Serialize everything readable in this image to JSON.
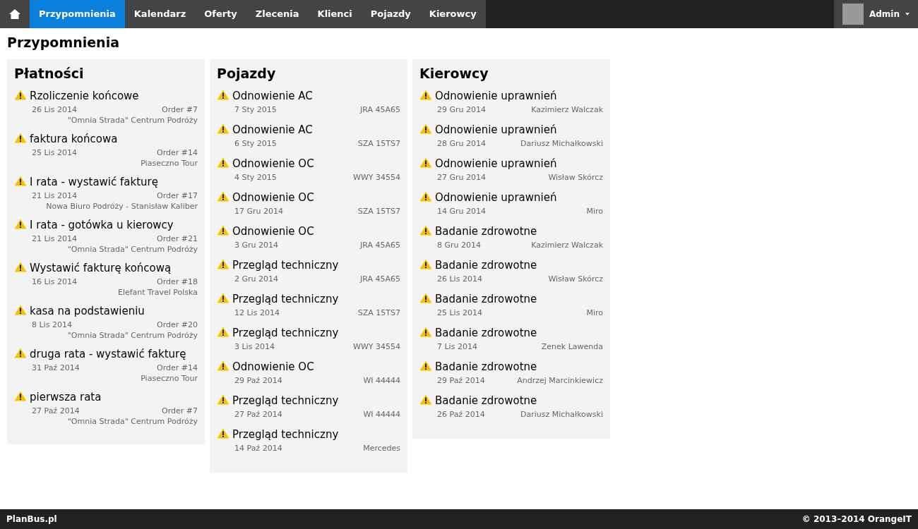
{
  "nav": {
    "items": [
      {
        "label": "Przypomnienia",
        "selected": true
      },
      {
        "label": "Kalendarz",
        "selected": false
      },
      {
        "label": "Oferty",
        "selected": false
      },
      {
        "label": "Zlecenia",
        "selected": false
      },
      {
        "label": "Klienci",
        "selected": false
      },
      {
        "label": "Pojazdy",
        "selected": false
      },
      {
        "label": "Kierowcy",
        "selected": false
      }
    ],
    "user": "Admin"
  },
  "page_title": "Przypomnienia",
  "panels": [
    {
      "title": "Płatności",
      "items": [
        {
          "title": "Rzoliczenie końcowe",
          "date": "26 Lis 2014",
          "ref": "Order #7",
          "client": "\"Omnia Strada\" Centrum Podróży"
        },
        {
          "title": "faktura końcowa",
          "date": "25 Lis 2014",
          "ref": "Order #14",
          "client": "Piaseczno Tour"
        },
        {
          "title": "I rata - wystawić fakturę",
          "date": "21 Lis 2014",
          "ref": "Order #17",
          "client": "Nowa Biuro Podróży - Stanisław Kaliber"
        },
        {
          "title": "I rata - gotówka u kierowcy",
          "date": "21 Lis 2014",
          "ref": "Order #21",
          "client": "\"Omnia Strada\" Centrum Podróży"
        },
        {
          "title": "Wystawić fakturę końcową",
          "date": "16 Lis 2014",
          "ref": "Order #18",
          "client": "Elefant Travel Polska"
        },
        {
          "title": "kasa na podstawieniu",
          "date": "8 Lis 2014",
          "ref": "Order #20",
          "client": "\"Omnia Strada\" Centrum Podróży"
        },
        {
          "title": "druga rata - wystawić fakturę",
          "date": "31 Paź 2014",
          "ref": "Order #14",
          "client": "Piaseczno Tour"
        },
        {
          "title": "pierwsza rata",
          "date": "27 Paź 2014",
          "ref": "Order #7",
          "client": "\"Omnia Strada\" Centrum Podróży"
        }
      ]
    },
    {
      "title": "Pojazdy",
      "items": [
        {
          "title": "Odnowienie AC",
          "date": "7 Sty 2015",
          "ref": "JRA 45A65"
        },
        {
          "title": "Odnowienie AC",
          "date": "6 Sty 2015",
          "ref": "SZA 15TS7"
        },
        {
          "title": "Odnowienie OC",
          "date": "4 Sty 2015",
          "ref": "WWY 34554"
        },
        {
          "title": "Odnowienie OC",
          "date": "17 Gru 2014",
          "ref": "SZA 15TS7"
        },
        {
          "title": "Odnowienie OC",
          "date": "3 Gru 2014",
          "ref": "JRA 45A65"
        },
        {
          "title": "Przegląd techniczny",
          "date": "2 Gru 2014",
          "ref": "JRA 45A65"
        },
        {
          "title": "Przegląd techniczny",
          "date": "12 Lis 2014",
          "ref": "SZA 15TS7"
        },
        {
          "title": "Przegląd techniczny",
          "date": "3 Lis 2014",
          "ref": "WWY 34554"
        },
        {
          "title": "Odnowienie OC",
          "date": "29 Paź 2014",
          "ref": "WI 44444"
        },
        {
          "title": "Przegląd techniczny",
          "date": "27 Paź 2014",
          "ref": "WI 44444"
        },
        {
          "title": "Przegląd techniczny",
          "date": "14 Paź 2014",
          "ref": "Mercedes"
        }
      ]
    },
    {
      "title": "Kierowcy",
      "items": [
        {
          "title": "Odnowienie uprawnień",
          "date": "29 Gru 2014",
          "ref": "Kazimierz Walczak"
        },
        {
          "title": "Odnowienie uprawnień",
          "date": "28 Gru 2014",
          "ref": "Dariusz Michałkowski"
        },
        {
          "title": "Odnowienie uprawnień",
          "date": "27 Gru 2014",
          "ref": "Wisław Skórcz"
        },
        {
          "title": "Odnowienie uprawnień",
          "date": "14 Gru 2014",
          "ref": "Miro"
        },
        {
          "title": "Badanie zdrowotne",
          "date": "8 Gru 2014",
          "ref": "Kazimierz Walczak"
        },
        {
          "title": "Badanie zdrowotne",
          "date": "26 Lis 2014",
          "ref": "Wisław Skórcz"
        },
        {
          "title": "Badanie zdrowotne",
          "date": "25 Lis 2014",
          "ref": "Miro"
        },
        {
          "title": "Badanie zdrowotne",
          "date": "7 Lis 2014",
          "ref": "Zenek Lawenda"
        },
        {
          "title": "Badanie zdrowotne",
          "date": "29 Paź 2014",
          "ref": "Andrzej Marcinkiewicz"
        },
        {
          "title": "Badanie zdrowotne",
          "date": "26 Paź 2014",
          "ref": "Dariusz Michałkowski"
        }
      ]
    }
  ],
  "footer": {
    "left": "PlanBus.pl",
    "right": "© 2013–2014 OrangeIT"
  }
}
